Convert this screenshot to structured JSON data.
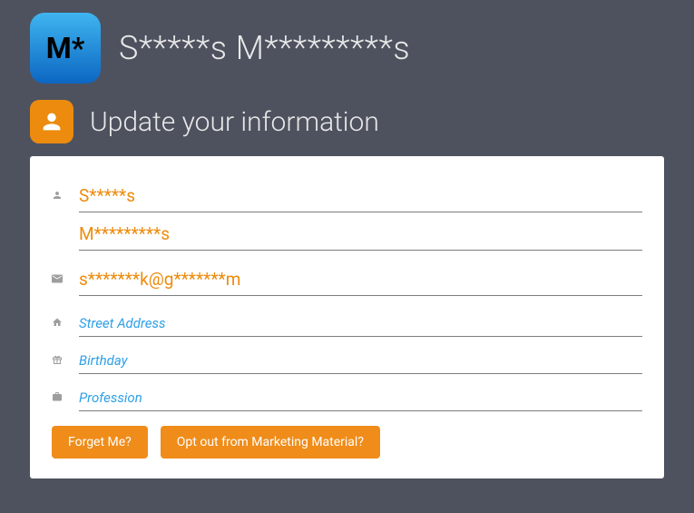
{
  "header": {
    "logoText": "M*",
    "appName": "S*****s M*********s"
  },
  "subtitle": "Update your information",
  "fields": {
    "firstName": "S*****s",
    "lastName": "M*********s",
    "email": "s*******k@g*******m",
    "streetPlaceholder": "Street Address",
    "birthdayPlaceholder": "Birthday",
    "professionPlaceholder": "Profession"
  },
  "buttons": {
    "forget": "Forget Me?",
    "optout": "Opt out from Marketing Material?"
  }
}
